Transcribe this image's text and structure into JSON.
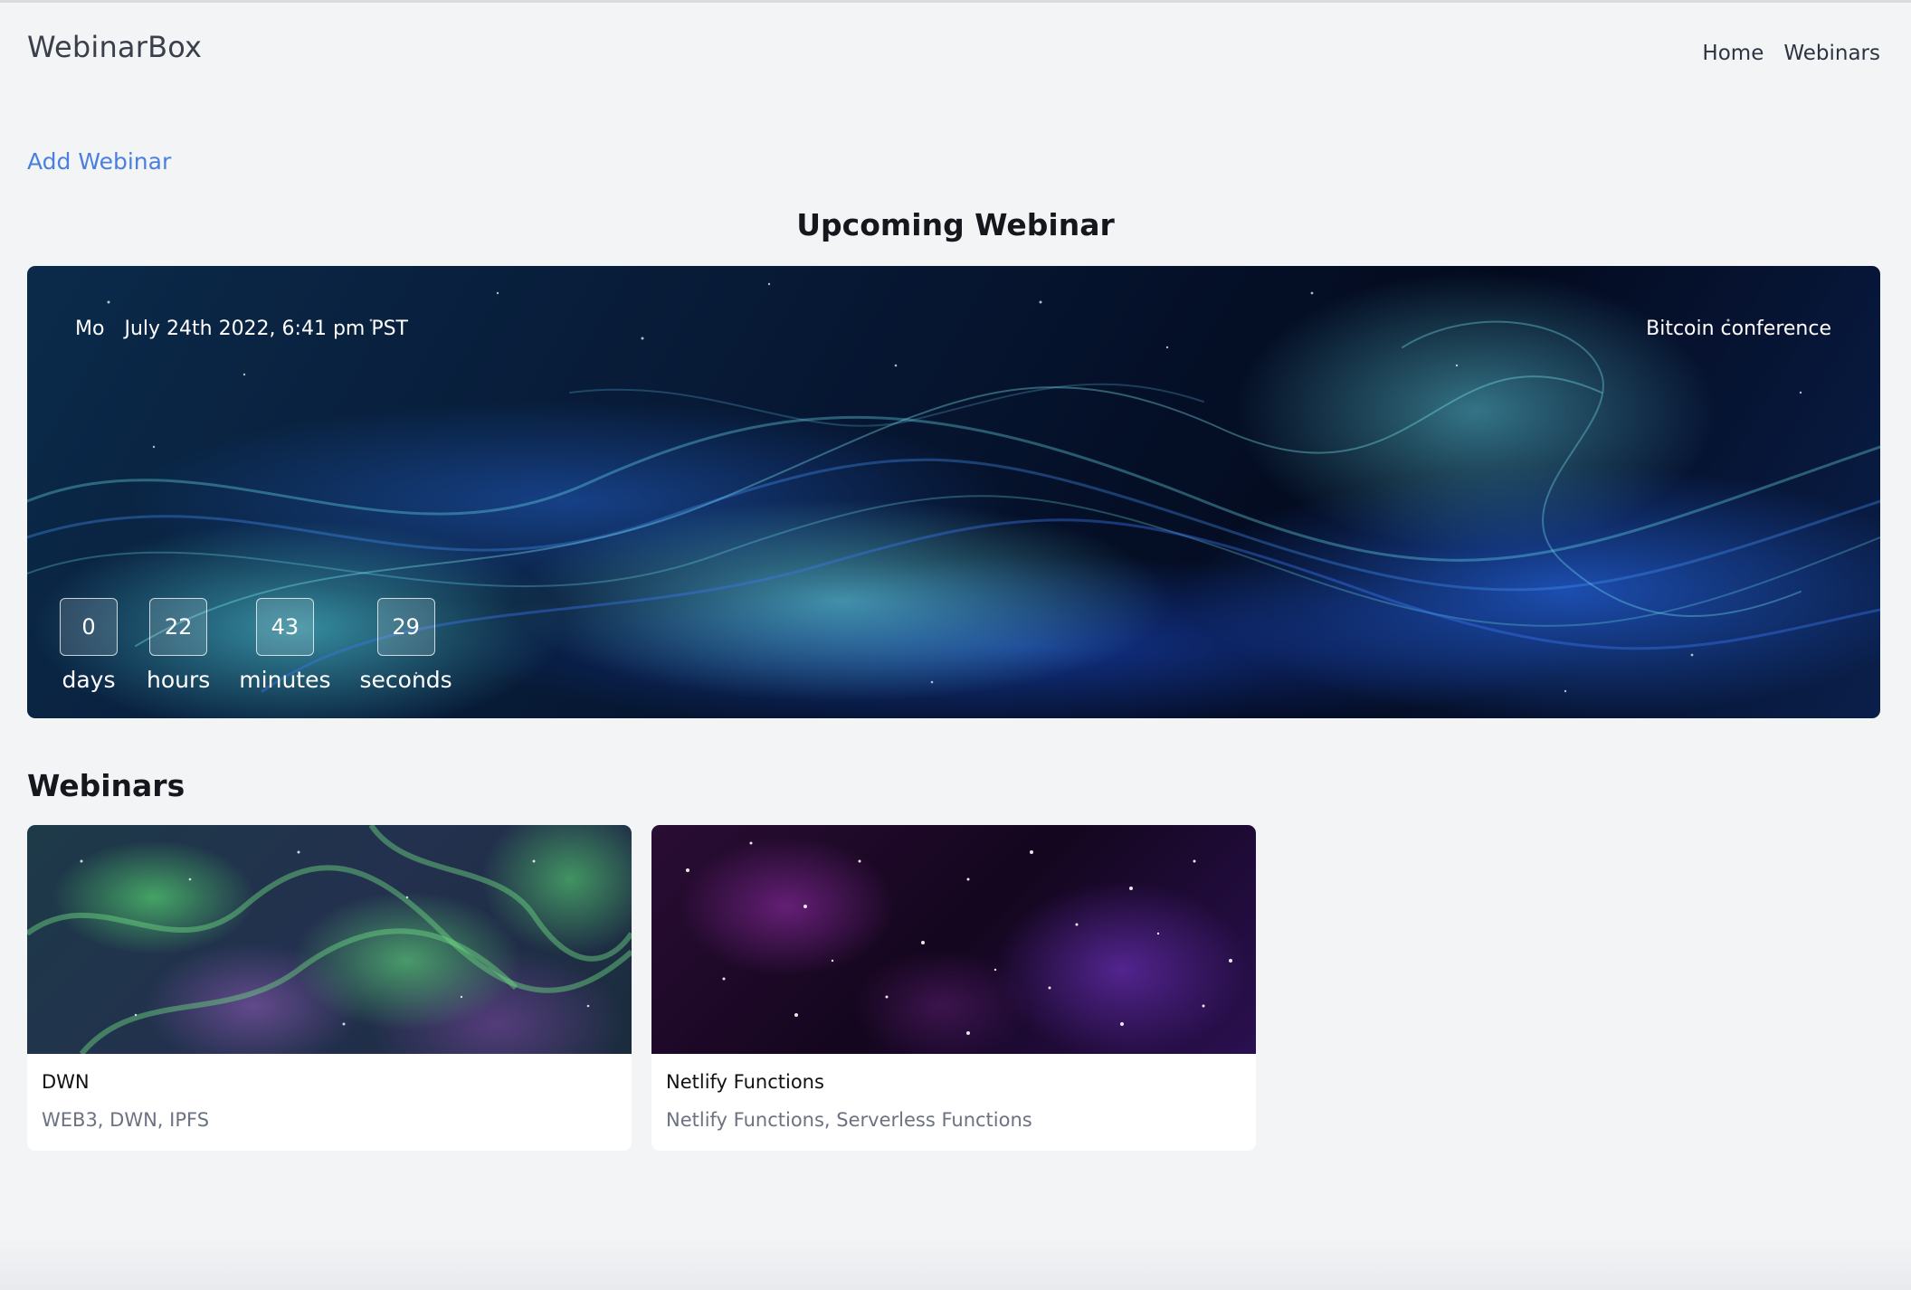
{
  "header": {
    "brand": "WebinarBox",
    "nav": [
      {
        "label": "Home"
      },
      {
        "label": "Webinars"
      }
    ]
  },
  "actions": {
    "add_webinar": "Add Webinar"
  },
  "upcoming": {
    "section_title": "Upcoming Webinar",
    "day": "Mo",
    "datetime": "July 24th 2022, 6:41 pm PST",
    "title": "Bitcoin conference",
    "countdown": [
      {
        "value": "0",
        "label": "days"
      },
      {
        "value": "22",
        "label": "hours"
      },
      {
        "value": "43",
        "label": "minutes"
      },
      {
        "value": "29",
        "label": "seconds"
      }
    ]
  },
  "webinars": {
    "section_title": "Webinars",
    "items": [
      {
        "name": "DWN",
        "tags": "WEB3, DWN, IPFS"
      },
      {
        "name": "Netlify Functions",
        "tags": "Netlify Functions, Serverless Functions"
      }
    ]
  },
  "colors": {
    "link": "#4a7fe0",
    "background": "#f3f4f6"
  }
}
